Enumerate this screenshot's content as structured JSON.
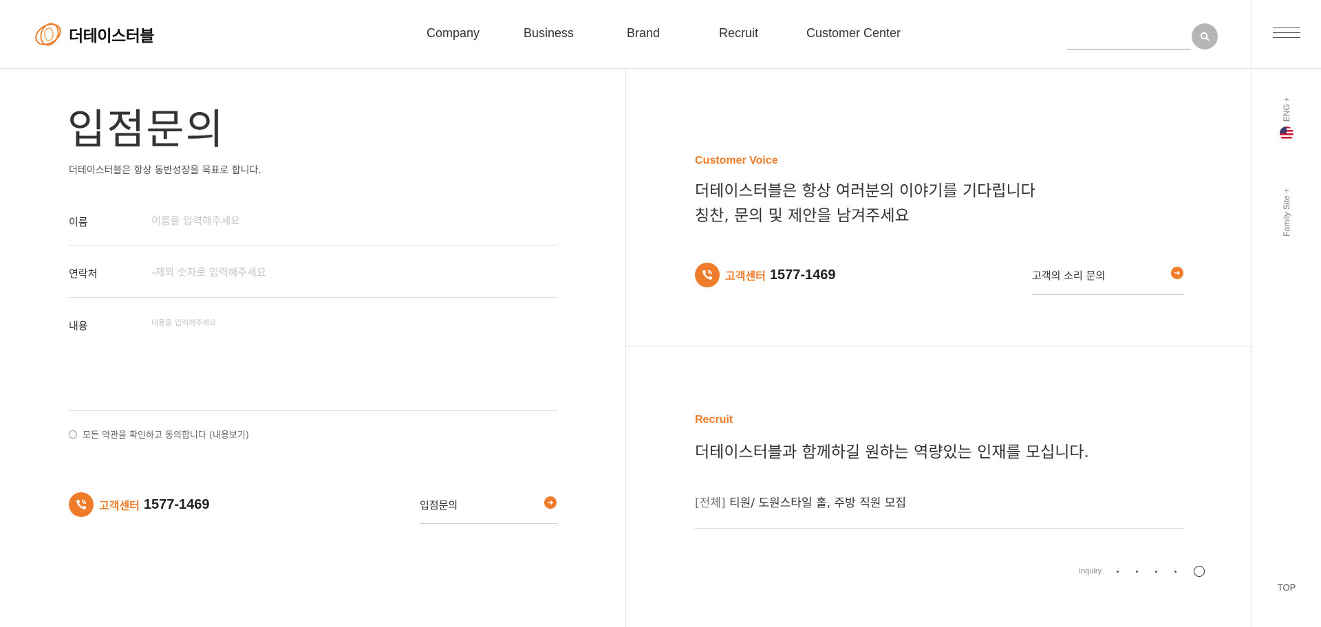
{
  "brand": {
    "name": "더테이스터블",
    "accent": "#ee7c2a"
  },
  "nav": [
    {
      "label": "Company"
    },
    {
      "label": "Business"
    },
    {
      "label": "Brand"
    },
    {
      "label": "Recruit"
    },
    {
      "label": "Customer Center"
    }
  ],
  "search": {
    "placeholder": "",
    "icon": "search-icon"
  },
  "sidebar": {
    "menu_icon": "hamburger-icon",
    "lang": "ENG +",
    "lang_flag": "us-flag-icon",
    "family_site": "Family Site +",
    "top": "TOP"
  },
  "inquiry": {
    "title": "입점문의",
    "subtitle": "더테이스터블은 항상 동반성장을 목표로 합니다.",
    "name_label": "이름",
    "name_placeholder": "이름을 입력해주세요",
    "contact_label": "연락처",
    "contact_placeholder": "-제외 숫자로 입력해주세요",
    "content_label": "내용",
    "content_placeholder": "내용을 입력해주세요",
    "agree_text": "모든 약관을 확인하고 동의합니다 (내용보기)",
    "phone_label": "고객센터",
    "phone_number": "1577-1469",
    "submit_label": "입점문의"
  },
  "customer_voice": {
    "label": "Customer Voice",
    "line1": "더테이스터블은 항상 여러분의 이야기를 기다립니다",
    "line2": "칭찬, 문의 및 제안을 남겨주세요",
    "phone_label": "고객센터",
    "phone_number": "1577-1469",
    "link_label": "고객의 소리 문의"
  },
  "recruit": {
    "label": "Recruit",
    "headline": "더테이스터블과 함께하길 원하는 역량있는 인재를 모십니다.",
    "item_category": "[전체]",
    "item_title": "티원/ 도원스타일 홀, 주방 직원 모집"
  },
  "pager": {
    "label": "Inquiry",
    "count": 5,
    "active_index": 4
  }
}
